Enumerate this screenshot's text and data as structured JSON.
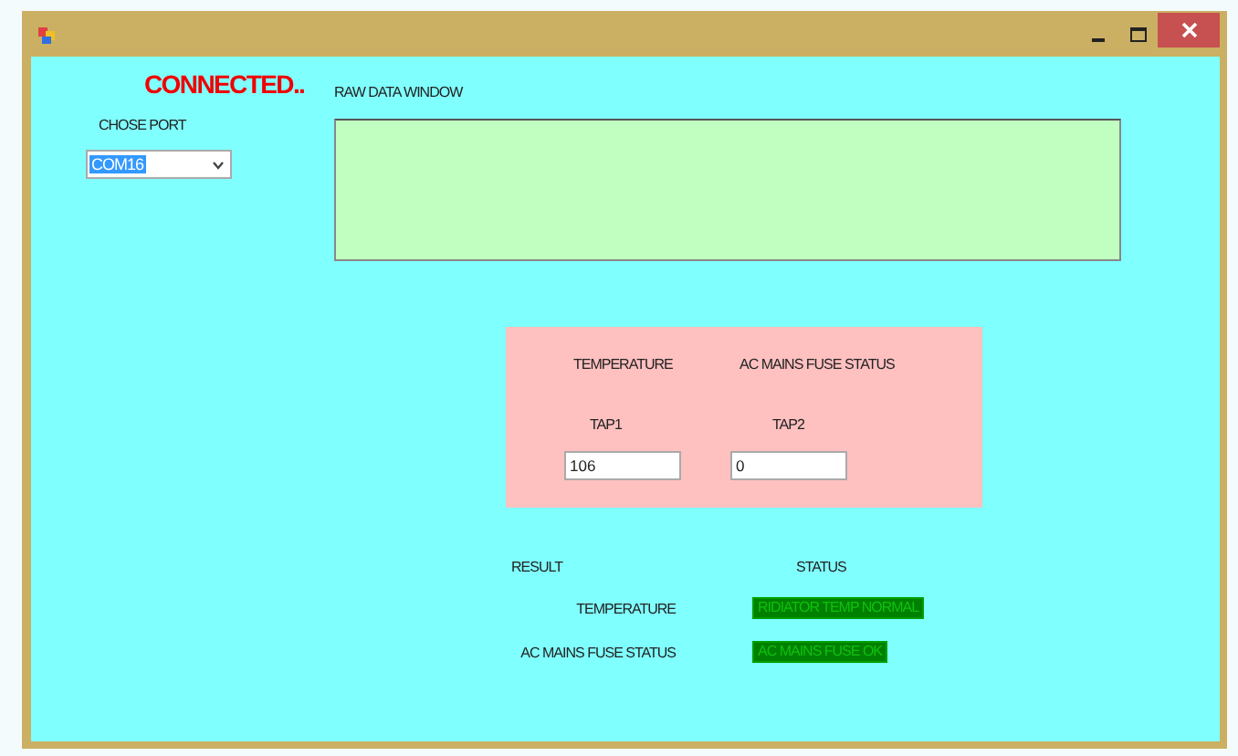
{
  "connection_status": "CONNECTED..",
  "raw_data_window": {
    "label": "RAW DATA WINDOW"
  },
  "port": {
    "label": "CHOSE PORT",
    "value": "COM16"
  },
  "inputs_panel": {
    "columns": [
      {
        "heading": "TEMPERATURE",
        "tap_label": "TAP1",
        "value": "106"
      },
      {
        "heading": "AC MAINS FUSE STATUS",
        "tap_label": "TAP2",
        "value": "0"
      }
    ]
  },
  "results": {
    "heading": "RESULT",
    "status_heading": "STATUS",
    "rows": [
      {
        "name": "TEMPERATURE",
        "status": "RIDIATOR TEMP NORMAL"
      },
      {
        "name": "AC MAINS FUSE STATUS",
        "status": "AC MAINS FUSE OK"
      }
    ]
  }
}
